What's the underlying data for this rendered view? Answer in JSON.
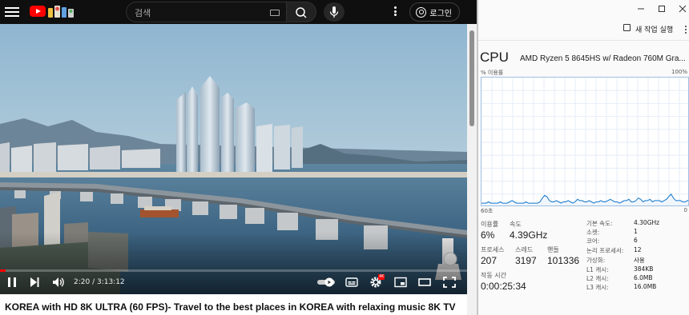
{
  "youtube": {
    "search": {
      "placeholder": "검색"
    },
    "login_label": "로그인",
    "player": {
      "time_text": "2:20 / 3:13:12",
      "progress": 0.012,
      "settings_badge": "4K"
    },
    "video_title": "KOREA with HD 8K ULTRA (60 FPS)- Travel to the best places in KOREA with relaxing music 8K TV"
  },
  "task_manager": {
    "toolbar": {
      "new_task_label": "새 작업 실행"
    },
    "title": "CPU",
    "cpu_name": "AMD Ryzen 5 8645HS w/ Radeon 760M Gra...",
    "graph": {
      "util_label": "% 이용률",
      "max_label": "100%",
      "time_label": "60초",
      "zero_label": "0"
    },
    "stats": {
      "utilization": {
        "label": "이용률",
        "value": "6%"
      },
      "speed": {
        "label": "속도",
        "value": "4.39GHz"
      },
      "processes": {
        "label": "프로세스",
        "value": "207"
      },
      "threads": {
        "label": "스레드",
        "value": "3197"
      },
      "handles": {
        "label": "핸들",
        "value": "101336"
      },
      "uptime": {
        "label": "작동 시간",
        "value": "0:00:25:34"
      }
    },
    "specs": [
      {
        "key": "기본 속도:",
        "value": "4.30GHz"
      },
      {
        "key": "소켓:",
        "value": "1"
      },
      {
        "key": "코어:",
        "value": "6"
      },
      {
        "key": "논리 프로세서:",
        "value": "12"
      },
      {
        "key": "가상화:",
        "value": "사용"
      },
      {
        "key": "L1 캐시:",
        "value": "384KB"
      },
      {
        "key": "L2 캐시:",
        "value": "6.0MB"
      },
      {
        "key": "L3 캐시:",
        "value": "16.0MB"
      }
    ],
    "cpu_history_percent": [
      3,
      3,
      3,
      4,
      3,
      3,
      3,
      3,
      4,
      3,
      3,
      3,
      4,
      5,
      4,
      3,
      3,
      3,
      3,
      4,
      3,
      3,
      3,
      3,
      3,
      4,
      7,
      9,
      8,
      5,
      4,
      4,
      5,
      4,
      3,
      4,
      4,
      5,
      4,
      3,
      4,
      6,
      5,
      5,
      4,
      4,
      5,
      4,
      3,
      4,
      4,
      5,
      4,
      4,
      5,
      6,
      5,
      4,
      4,
      3,
      4,
      5,
      5,
      6,
      4,
      4,
      5,
      7,
      6,
      4,
      5,
      5,
      6,
      4,
      5,
      5,
      5,
      4,
      5,
      6,
      8,
      10,
      7,
      5,
      5,
      5,
      4,
      4,
      5,
      6
    ]
  }
}
